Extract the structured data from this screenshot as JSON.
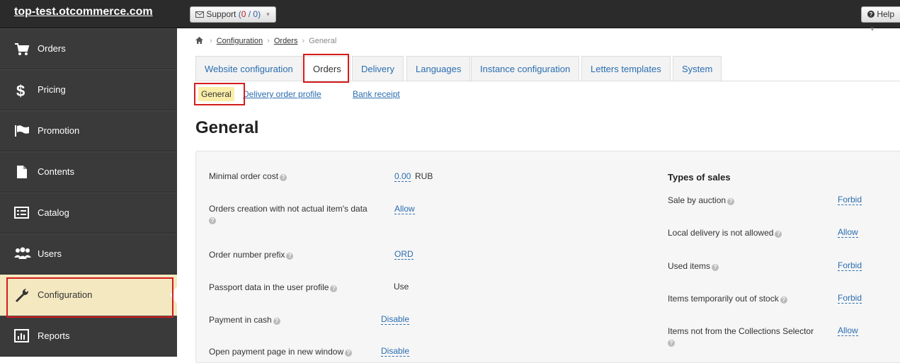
{
  "topbar": {
    "brand": "top-test.otcommerce.com",
    "support_label": "Support",
    "support_open": "0",
    "support_sep": " / ",
    "support_total": "0",
    "help_label": "Help"
  },
  "sidebar": {
    "items": [
      {
        "label": "Orders",
        "icon": "cart-icon"
      },
      {
        "label": "Pricing",
        "icon": "dollar-icon"
      },
      {
        "label": "Promotion",
        "icon": "flag-icon"
      },
      {
        "label": "Contents",
        "icon": "document-icon"
      },
      {
        "label": "Catalog",
        "icon": "list-icon"
      },
      {
        "label": "Users",
        "icon": "users-icon"
      },
      {
        "label": "Configuration",
        "icon": "wrench-icon",
        "active": true
      },
      {
        "label": "Reports",
        "icon": "bar-chart-icon"
      }
    ]
  },
  "breadcrumb": {
    "items": [
      "Configuration",
      "Orders",
      "General"
    ]
  },
  "tabs": [
    {
      "label": "Website configuration"
    },
    {
      "label": "Orders",
      "active": true
    },
    {
      "label": "Delivery"
    },
    {
      "label": "Languages"
    },
    {
      "label": "Instance configuration"
    },
    {
      "label": "Letters templates"
    },
    {
      "label": "System"
    }
  ],
  "subtabs": [
    {
      "label": "General",
      "active": true
    },
    {
      "label": "Delivery order profile"
    },
    {
      "label": "Bank receipt"
    }
  ],
  "page_title": "General",
  "left_settings": [
    {
      "label": "Minimal order cost",
      "value": "0.00",
      "unit": "RUB"
    },
    {
      "label": "Orders creation with not actual item's data",
      "value": "Allow"
    },
    {
      "label": "Order number prefix",
      "value": "ORD"
    },
    {
      "label": "Passport data in the user profile",
      "value": "Use"
    },
    {
      "label": "Payment in cash",
      "value": "Disable"
    },
    {
      "label": "Open payment page in new window",
      "value": "Disable"
    }
  ],
  "types_of_sales": {
    "title": "Types of sales",
    "items": [
      {
        "label": "Sale by auction",
        "value": "Forbid"
      },
      {
        "label": "Local delivery is not allowed",
        "value": "Allow"
      },
      {
        "label": "Used items",
        "value": "Forbid"
      },
      {
        "label": "Items temporarily out of stock",
        "value": "Forbid"
      },
      {
        "label": "Items not from the Collections Selector",
        "value": "Allow"
      }
    ]
  },
  "colors": {
    "accent": "#2a6db0",
    "highlight": "#d41c1c",
    "active_bg": "#f3e8c0"
  }
}
